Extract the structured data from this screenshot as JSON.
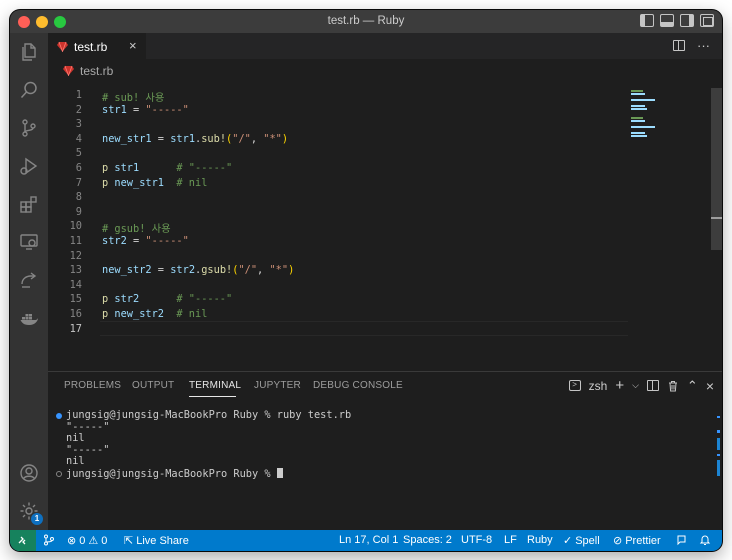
{
  "window": {
    "title": "test.rb — Ruby"
  },
  "tab": {
    "label": "test.rb",
    "close": "×"
  },
  "breadcrumb": {
    "file": "test.rb"
  },
  "editor": {
    "lines": [
      {
        "n": "1"
      },
      {
        "n": "2"
      },
      {
        "n": "3"
      },
      {
        "n": "4"
      },
      {
        "n": "5"
      },
      {
        "n": "6"
      },
      {
        "n": "7"
      },
      {
        "n": "8"
      },
      {
        "n": "9"
      },
      {
        "n": "10"
      },
      {
        "n": "11"
      },
      {
        "n": "12"
      },
      {
        "n": "13"
      },
      {
        "n": "14"
      },
      {
        "n": "15"
      },
      {
        "n": "16"
      },
      {
        "n": "17"
      }
    ],
    "code": {
      "l1": "# sub! 사용",
      "l2_var": "str1",
      "l2_eq": " = ",
      "l2_str": "\"-----\"",
      "l4_var": "new_str1",
      "l4_eq": " = ",
      "l4_recv": "str1",
      "l4_dot": ".",
      "l4_fn": "sub!",
      "l4_open": "(",
      "l4_a1": "\"/\"",
      "l4_comma": ", ",
      "l4_a2": "\"*\"",
      "l4_close": ")",
      "l6_kw": "p",
      "l6_var": " str1",
      "l6_cmt": "      # \"-----\"",
      "l7_kw": "p",
      "l7_var": " new_str1",
      "l7_cmt": "  # nil",
      "l10": "# gsub! 사용",
      "l11_var": "str2",
      "l11_eq": " = ",
      "l11_str": "\"-----\"",
      "l13_var": "new_str2",
      "l13_eq": " = ",
      "l13_recv": "str2",
      "l13_dot": ".",
      "l13_fn": "gsub!",
      "l13_open": "(",
      "l13_a1": "\"/\"",
      "l13_comma": ", ",
      "l13_a2": "\"*\"",
      "l13_close": ")",
      "l15_kw": "p",
      "l15_var": " str2",
      "l15_cmt": "      # \"-----\"",
      "l16_kw": "p",
      "l16_var": " new_str2",
      "l16_cmt": "  # nil"
    }
  },
  "panel": {
    "tabs": [
      "PROBLEMS",
      "OUTPUT",
      "TERMINAL",
      "JUPYTER",
      "DEBUG CONSOLE"
    ],
    "active_tab": "TERMINAL",
    "shell": "zsh",
    "shell_glyph": ">",
    "add": "+",
    "chevron": "⌵",
    "maximize": "⌃",
    "close": "×",
    "terminal_lines": [
      "jungsig@jungsig-MacBookPro Ruby % ruby test.rb",
      "\"-----\"",
      "nil",
      "\"-----\"",
      "nil",
      "jungsig@jungsig-MacBookPro Ruby % "
    ]
  },
  "status": {
    "errors": "0",
    "warnings": "0",
    "live_share": "Live Share",
    "position": "Ln 17, Col 1",
    "spaces": "Spaces: 2",
    "encoding": "UTF-8",
    "eol": "LF",
    "language": "Ruby",
    "spell": "Spell",
    "prettier": "Prettier"
  },
  "activity": {
    "accounts_badge": "1"
  },
  "colors": {
    "accent": "#007acc",
    "remote": "#16825d",
    "comment": "#6a9955",
    "string": "#ce9178",
    "variable": "#9cdcfe",
    "function": "#dcdcaa"
  }
}
